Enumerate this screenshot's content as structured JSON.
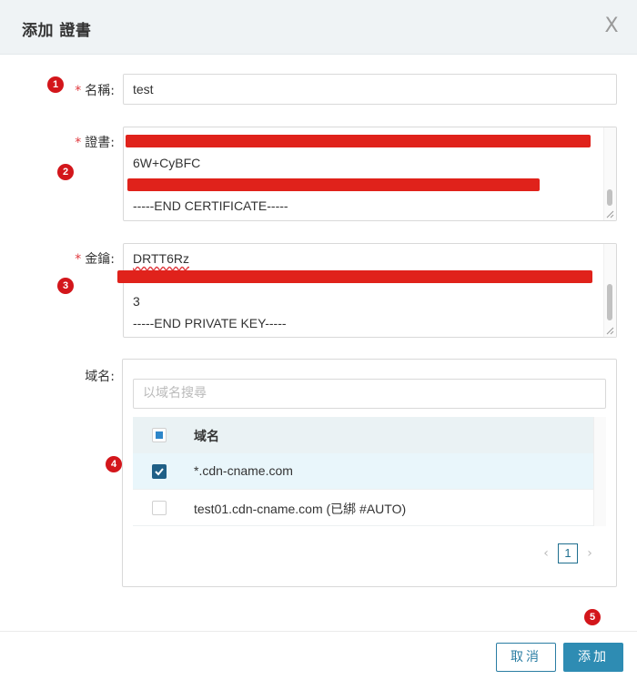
{
  "dialog": {
    "title": "添加 證書",
    "close_symbol": "X"
  },
  "markers": [
    "1",
    "2",
    "3",
    "4",
    "5"
  ],
  "form": {
    "required_mark": "*",
    "name": {
      "label": "名稱:",
      "value": "test"
    },
    "certificate": {
      "label": "證書:",
      "lines": [
        "6W+CyBFC",
        "-----END CERTIFICATE-----"
      ]
    },
    "private_key": {
      "label": "金鑰:",
      "lines": [
        "DRTT6Rz",
        "3",
        "-----END PRIVATE KEY-----"
      ]
    },
    "domains": {
      "label": "域名:",
      "search_placeholder": "以域名搜尋",
      "column_header": "域名",
      "rows": [
        {
          "name": "*.cdn-cname.com",
          "checked": true
        },
        {
          "name": "test01.cdn-cname.com (已綁 #AUTO)",
          "checked": false
        }
      ],
      "pagination": {
        "prev": "‹",
        "page": "1",
        "next": "›"
      }
    }
  },
  "footer": {
    "cancel_label": "取消",
    "add_label": "添加"
  },
  "colors": {
    "primary": "#2e8cb3",
    "marker": "#d3161b",
    "redaction": "#e0221b"
  }
}
